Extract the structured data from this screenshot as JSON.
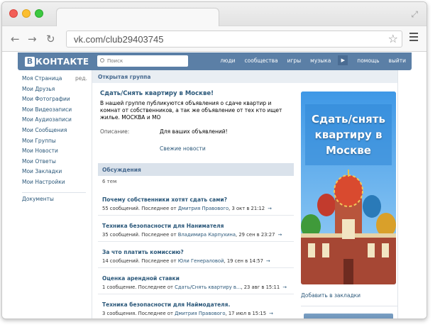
{
  "browser": {
    "url": "vk.com/club29403745"
  },
  "vk_header": {
    "logo_letter": "В",
    "logo_text": "КОНТАКТЕ",
    "search_placeholder": "Поиск",
    "nav": [
      "люди",
      "сообщества",
      "игры",
      "музыка",
      "помощь",
      "выйти"
    ]
  },
  "sidebar": {
    "items": [
      {
        "label": "Моя Страница",
        "edit": "ред."
      },
      {
        "label": "Мои Друзья"
      },
      {
        "label": "Мои Фотографии"
      },
      {
        "label": "Мои Видеозаписи"
      },
      {
        "label": "Мои Аудиозаписи"
      },
      {
        "label": "Мои Сообщения"
      },
      {
        "label": "Мои Группы"
      },
      {
        "label": "Мои Новости"
      },
      {
        "label": "Мои Ответы"
      },
      {
        "label": "Мои Закладки"
      },
      {
        "label": "Мои Настройки"
      }
    ],
    "extra": "Документы"
  },
  "main": {
    "header": "Открытая группа",
    "group_title": "Сдать/Снять квартиру в Москве!",
    "group_description": "В нашей группе публикуются объявления о сдаче квартир и комнат от собственников, а так же объявление от тех кто ищет жилье. МОСКВА и МО",
    "desc_label": "Описание:",
    "desc_value": "Для ваших объявлений!",
    "fresh_news": "Свежие новости",
    "discussions_title": "Обсуждения",
    "discussions_count": "6 тем",
    "topics": [
      {
        "title": "Почему собственники хотят сдать сами?",
        "pre": "55 сообщений. Последнее от ",
        "author": "Дмитрия Правового",
        "date": ", 3 окт в 21:12"
      },
      {
        "title": "Техника безопасности для Нанимателя",
        "pre": "35 сообщений. Последнее от ",
        "author": "Владимира Карпухина",
        "date": ", 29 сен в 23:27"
      },
      {
        "title": "За что платить комиссию?",
        "pre": "14 сообщений. Последнее от ",
        "author": "Юли Генераловой",
        "date": ", 19 сен в 14:57"
      },
      {
        "title": "Оценка арендной ставки",
        "pre": "1 сообщение. Последнее от ",
        "author": "Сдать/Снять квартиру в...",
        "date": ", 23 авг в 15:11"
      },
      {
        "title": "Техника безопасности для Наймодателя.",
        "pre": "3 сообщения. Последнее от ",
        "author": "Дмитрия Правового",
        "date": ", 17 июл в 15:15"
      }
    ],
    "arrow": "→"
  },
  "right": {
    "banner_lines": [
      "Сдать/снять",
      "квартиру в",
      "Москве"
    ],
    "bookmark": "Добавить в закладки"
  }
}
